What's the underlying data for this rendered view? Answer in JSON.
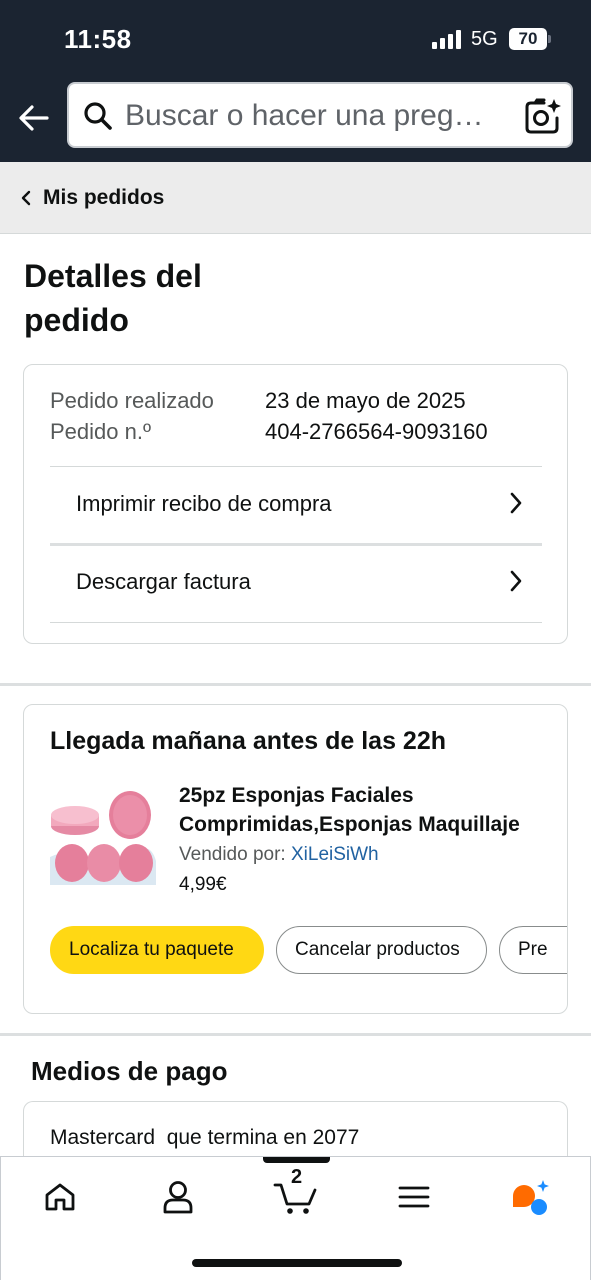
{
  "status_bar": {
    "time": "11:58",
    "network": "5G",
    "battery": "70"
  },
  "search": {
    "placeholder": "Buscar o hacer una preg…"
  },
  "breadcrumb": {
    "label": "Mis pedidos"
  },
  "page": {
    "title": "Detalles del pedido"
  },
  "order_info": {
    "placed_label": "Pedido realizado",
    "placed_value": "23 de mayo de 2025",
    "number_label": "Pedido n.º",
    "number_value": "404-2766564-9093160",
    "actions": [
      {
        "label": "Imprimir recibo de compra"
      },
      {
        "label": "Descargar factura"
      }
    ]
  },
  "shipment": {
    "heading": "Llegada mañana antes de las 22h",
    "product": {
      "title_line1": "25pz Esponjas Faciales",
      "title_line2": "Comprimidas,Esponjas Maquillaje",
      "seller_label": "Vendido por:",
      "seller_name": "XiLeiSiWh",
      "price": "4,99€"
    },
    "buttons": {
      "track": "Localiza tu paquete",
      "cancel": "Cancelar productos",
      "more": "Pre"
    }
  },
  "payment": {
    "title": "Medios de pago",
    "method": "Mastercard  que termina en 2077"
  },
  "bottom_nav": {
    "items": [
      "home-icon",
      "account-icon",
      "cart-icon",
      "menu-icon",
      "rufus-ai-icon"
    ],
    "cart_count": "2"
  },
  "colors": {
    "header_bg": "#1b2431",
    "primary_button": "#ffd814",
    "link": "#2162a1",
    "assistant_orange": "#ff6b00",
    "assistant_blue": "#1a8cff"
  }
}
